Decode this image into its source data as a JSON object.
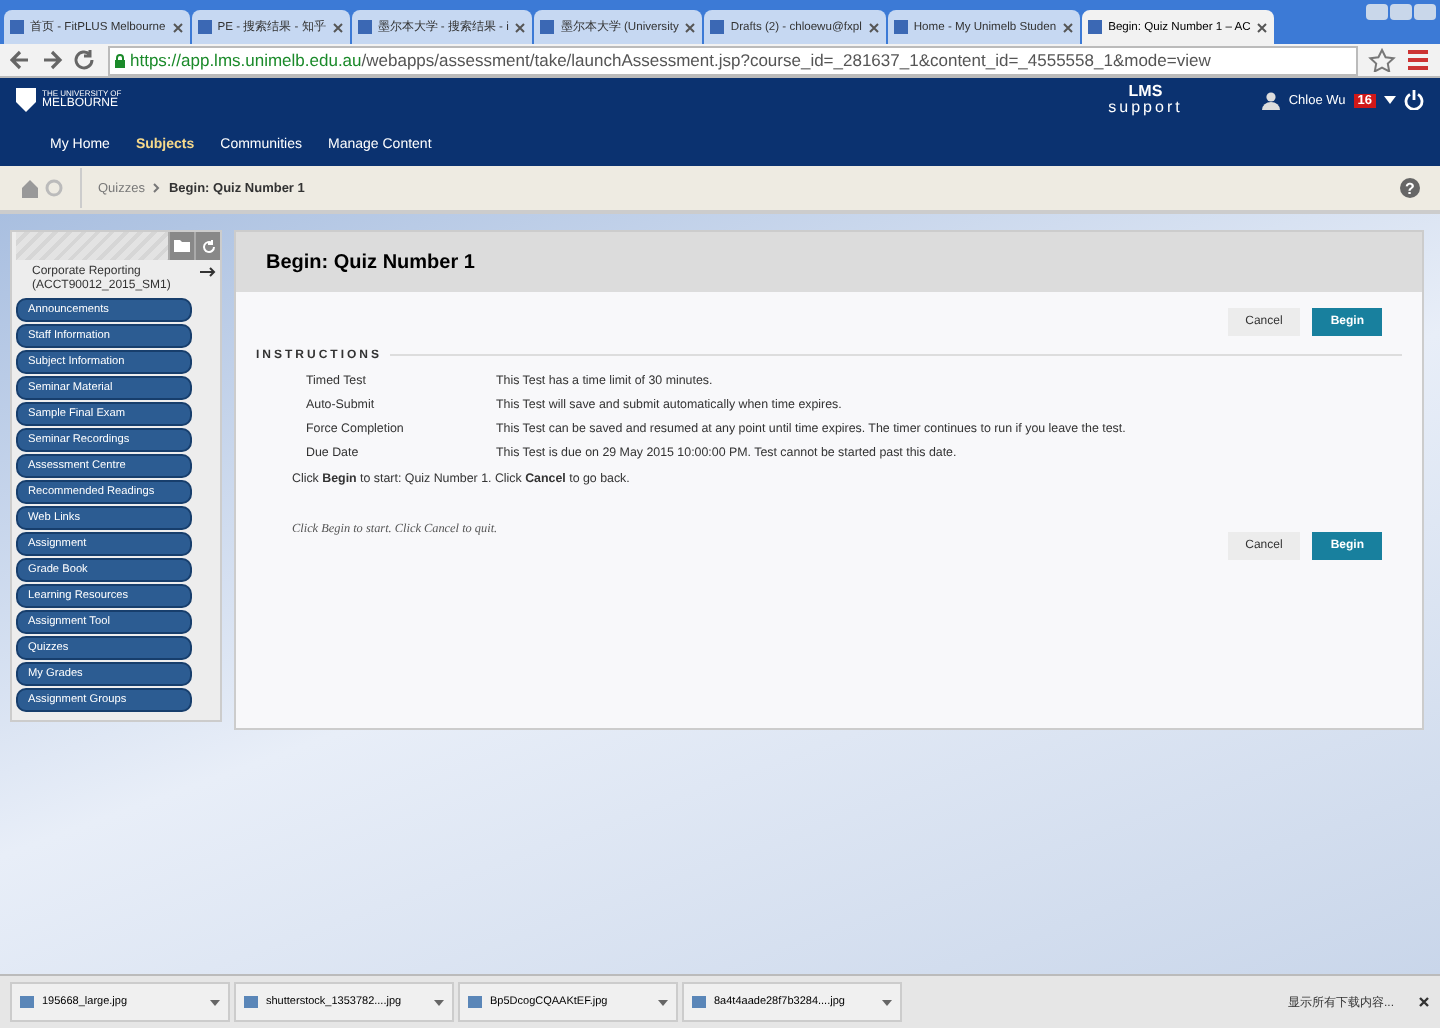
{
  "browser": {
    "tabs": [
      {
        "label": "首页 - FitPLUS Melbourne",
        "selected": false
      },
      {
        "label": "PE - 搜索结果 - 知乎",
        "selected": false
      },
      {
        "label": "墨尔本大学 - 搜索结果 - i",
        "selected": false
      },
      {
        "label": "墨尔本大学 (University",
        "selected": false
      },
      {
        "label": "Drafts (2) - chloewu@fxpl",
        "selected": false
      },
      {
        "label": "Home - My Unimelb Studen",
        "selected": false
      },
      {
        "label": "Begin: Quiz Number 1 – AC",
        "selected": true
      }
    ],
    "url_host": "https://app.lms.unimelb.edu.au",
    "url_path": "/webapps/assessment/take/launchAssessment.jsp?course_id=_281637_1&content_id=_4555558_1&mode=view"
  },
  "header": {
    "logo_top": "THE UNIVERSITY OF",
    "logo_name": "MELBOURNE",
    "lms_title": "LMS",
    "lms_subtitle": "support",
    "user": "Chloe Wu",
    "badge": "16"
  },
  "nav": [
    {
      "label": "My Home",
      "selected": false
    },
    {
      "label": "Subjects",
      "selected": true
    },
    {
      "label": "Communities",
      "selected": false
    },
    {
      "label": "Manage Content",
      "selected": false
    }
  ],
  "breadcrumb": {
    "parent": "Quizzes",
    "current": "Begin: Quiz Number 1",
    "help": "?"
  },
  "sidebar": {
    "course": "Corporate Reporting (ACCT90012_2015_SM1)",
    "items": [
      "Announcements",
      "Staff Information",
      "Subject Information",
      "Seminar Material",
      "Sample Final Exam",
      "Seminar Recordings",
      "Assessment Centre",
      "Recommended Readings",
      "Web Links",
      "Assignment",
      "Grade Book",
      "Learning Resources",
      "Assignment Tool",
      "Quizzes",
      "My Grades",
      "Assignment Groups"
    ]
  },
  "content": {
    "title": "Begin: Quiz Number 1",
    "cancel": "Cancel",
    "begin": "Begin",
    "section": "INSTRUCTIONS",
    "instructions": [
      {
        "label": "Timed Test",
        "value": "This Test has a time limit of 30 minutes."
      },
      {
        "label": "Auto-Submit",
        "value": "This Test will save and submit automatically when time expires."
      },
      {
        "label": "Force Completion",
        "value": "This Test can be saved and resumed at any point until time expires. The timer continues to run if you leave the test."
      },
      {
        "label": "Due Date",
        "value": "This Test is due on 29 May 2015 10:00:00 PM. Test cannot be started past this date."
      }
    ],
    "start_note": "Click **Begin** to start: Quiz Number 1. Click **Cancel** to go back.",
    "quit_note": "Click Begin to start. Click Cancel to quit.",
    "cancel_bottom": "Cancel",
    "begin_bottom": "Begin"
  },
  "downloads": {
    "files": [
      "195668_large.jpg",
      "shutterstock_1353782....jpg",
      "Bp5DcogCQAAKtEF.jpg",
      "8a4t4aade28f7b3284....jpg"
    ],
    "show_all": "显示所有下载内容..."
  }
}
